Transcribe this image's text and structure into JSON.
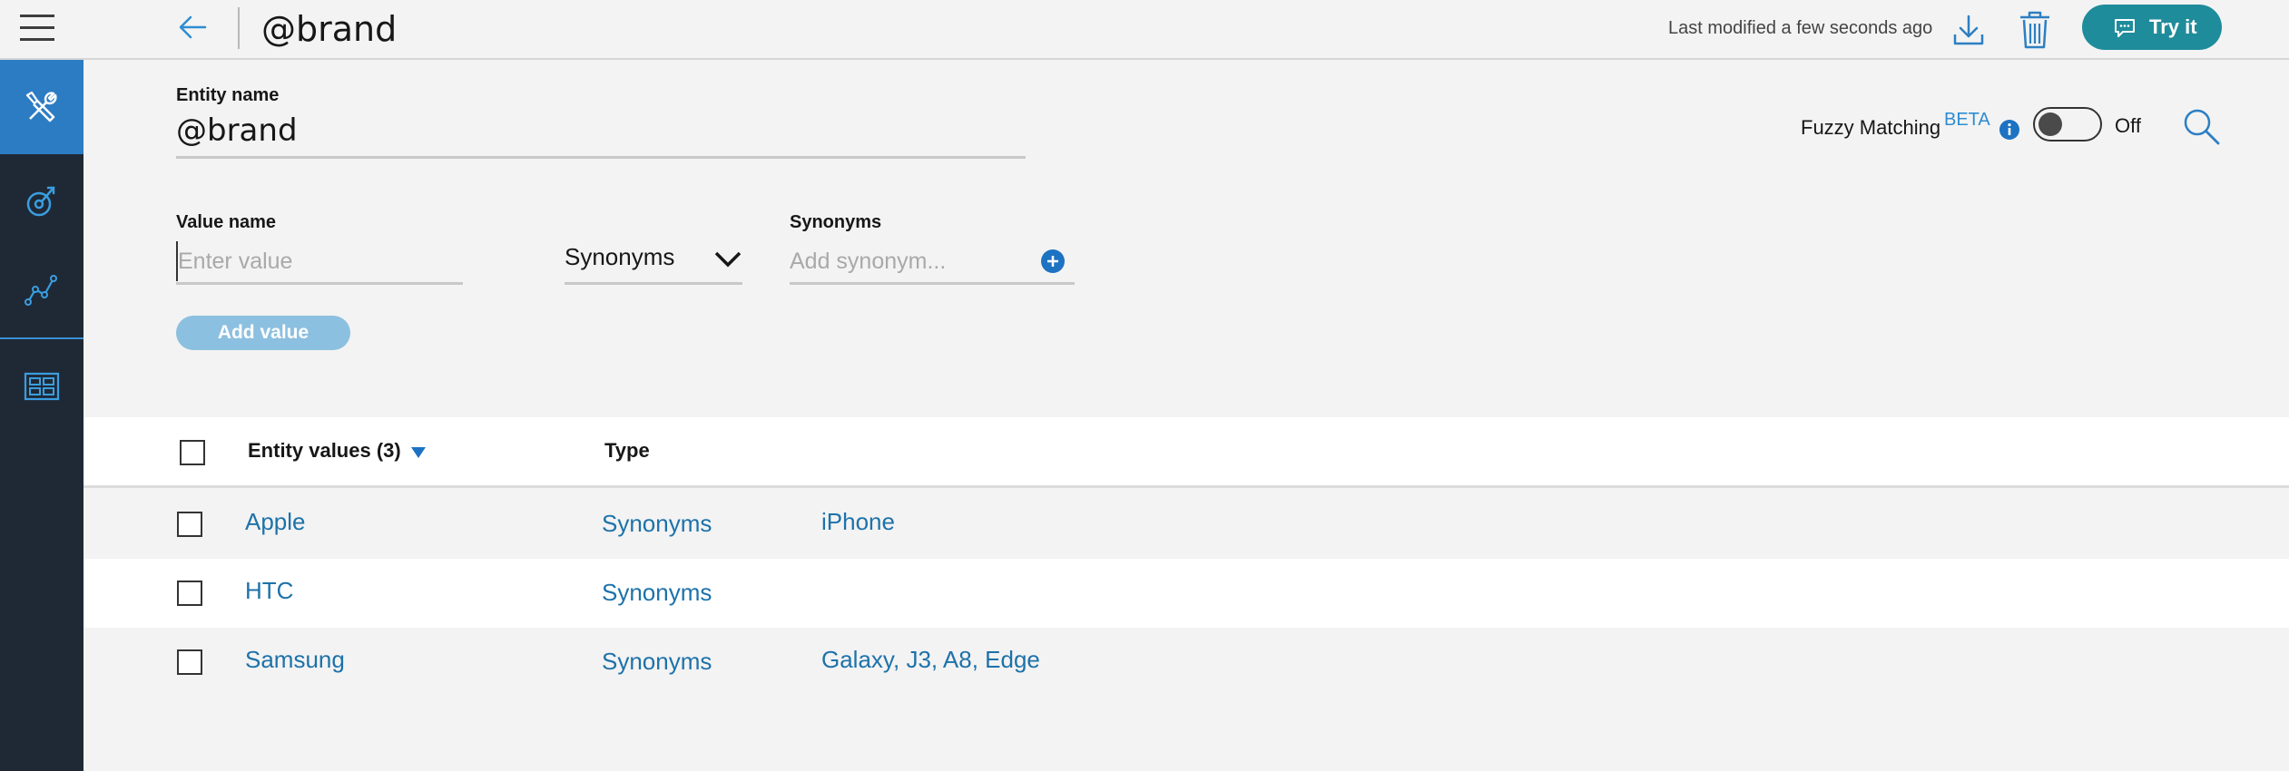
{
  "header": {
    "title": "@brand",
    "last_modified": "Last modified a few seconds ago",
    "try_it_label": "Try it"
  },
  "form": {
    "entity_name_label": "Entity name",
    "entity_name_value": "@brand",
    "value_name_label": "Value name",
    "value_placeholder": "Enter value",
    "type_select_value": "Synonyms",
    "synonyms_label": "Synonyms",
    "synonym_placeholder": "Add synonym...",
    "add_value_label": "Add value"
  },
  "fuzzy": {
    "label": "Fuzzy Matching",
    "badge": "BETA",
    "state": "Off"
  },
  "table": {
    "header_values": "Entity values (3)",
    "header_type": "Type",
    "rows": [
      {
        "value": "Apple",
        "type": "Synonyms",
        "synonyms": "iPhone"
      },
      {
        "value": "HTC",
        "type": "Synonyms",
        "synonyms": ""
      },
      {
        "value": "Samsung",
        "type": "Synonyms",
        "synonyms": "Galaxy, J3, A8, Edge"
      }
    ]
  },
  "colors": {
    "accent": "#1f8c9b",
    "link": "#1d72aa",
    "sidebar": "#1f2936",
    "sidebar_active": "#2c7cc4"
  },
  "icons": {
    "menu": "hamburger-icon",
    "back": "arrow-left-icon",
    "download": "download-icon",
    "delete": "trash-icon",
    "chat": "chat-bubble-icon",
    "search": "search-icon"
  }
}
